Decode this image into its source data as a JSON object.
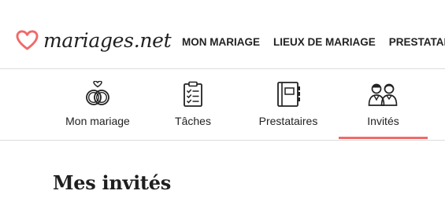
{
  "brand": {
    "name": "mariages.net",
    "accent_color": "#f06a6a",
    "logo_icon": "heart-logo-icon"
  },
  "main_nav": {
    "items": [
      {
        "label": "MON MARIAGE"
      },
      {
        "label": "LIEUX DE MARIAGE"
      },
      {
        "label": "PRESTATAIRES"
      }
    ]
  },
  "tabs": {
    "active_index": 3,
    "items": [
      {
        "label": "Mon mariage",
        "icon": "wedding-rings-icon"
      },
      {
        "label": "Tâches",
        "icon": "clipboard-checklist-icon"
      },
      {
        "label": "Prestataires",
        "icon": "address-book-icon"
      },
      {
        "label": "Invités",
        "icon": "guests-icon"
      }
    ]
  },
  "page": {
    "title": "Mes invités"
  }
}
